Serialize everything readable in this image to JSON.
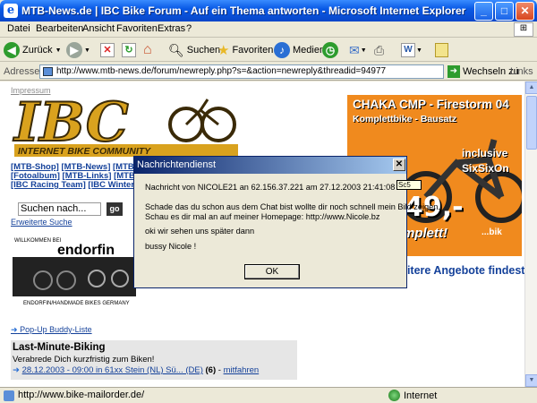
{
  "window": {
    "title": "MTB-News.de | IBC Bike Forum - Auf ein Thema antworten - Microsoft Internet Explorer"
  },
  "menu": [
    "Datei",
    "Bearbeiten",
    "Ansicht",
    "Favoriten",
    "Extras",
    "?"
  ],
  "toolbar": {
    "back": "Zurück",
    "search": "Suchen",
    "favorites": "Favoriten",
    "media": "Medien"
  },
  "addressbar": {
    "label": "Adresse",
    "url": "http://www.mtb-news.de/forum/newreply.php?s=&action=newreply&threadid=94977",
    "go": "Wechseln zu",
    "links": "Links"
  },
  "page": {
    "impressum": "Impressum",
    "logo_text": "IBC",
    "logo_sub": "INTERNET BIKE COMMUNITY",
    "nav": [
      {
        "a": "[MTB-Shop]",
        "b": "[MTB-News]",
        "c": "[MTB-Fo"
      },
      {
        "a": "[Fotoalbum]",
        "b": "[MTB-Links]",
        "c": "[MTB-F"
      },
      {
        "a": "[IBC Racing Team]",
        "b": "[IBC Winterp",
        "c": ""
      }
    ],
    "search_placeholder": "Suchen nach...",
    "search_go": "go",
    "extended_search": "Erweiterte Suche",
    "endorfin_top": "WILLKOMMEN BEI",
    "endorfin_brand": "endorfin",
    "endorfin_bottom": "ENDORFIN/HANDMADE BIKES GERMANY",
    "popup_link": "Pop-Up Buddy-Liste",
    "lastminute": {
      "heading": "Last-Minute-Biking",
      "sub": "Verabrede Dich kurzfristig zum Biken!",
      "entry_link": "28.12.2003 - 09:00 in 61xx Stein (NL) Sü... (DE)",
      "entry_count": "(6)",
      "entry_sep": " - ",
      "entry_action": "mitfahren"
    },
    "ad": {
      "headline": "CHAKA CMP - Firestorm 04",
      "sub": "Komplettbike - Bausatz",
      "inclusive": "inclusive",
      "sixsix": "SixSixOn",
      "price": "49,-",
      "komplett": "mplett!",
      "brand": "...bik",
      "more": "eitere Angebote findest"
    }
  },
  "dialog": {
    "title": "Nachrichtendienst",
    "line1": "Nachricht von NICOLE21 an 62.156.37.221 am 27.12.2003 21:41:08",
    "line2": "Schade das du schon aus dem Chat bist wollte dir noch schnell mein Bild zeigen.",
    "line3": "Schau es dir mal an auf meiner Homepage: http://www.Nicole.bz",
    "line4": "oki wir sehen uns später dann",
    "line5": "bussy Nicole !",
    "ok": "OK",
    "tooltip": "Sc5"
  },
  "status": {
    "url": "http://www.bike-mailorder.de/",
    "zone": "Internet"
  },
  "colors": {
    "titlebar": "#0a5ae6",
    "ad_orange": "#f08a1e",
    "link_blue": "#14419a",
    "logo_gold": "#d9a21e"
  }
}
